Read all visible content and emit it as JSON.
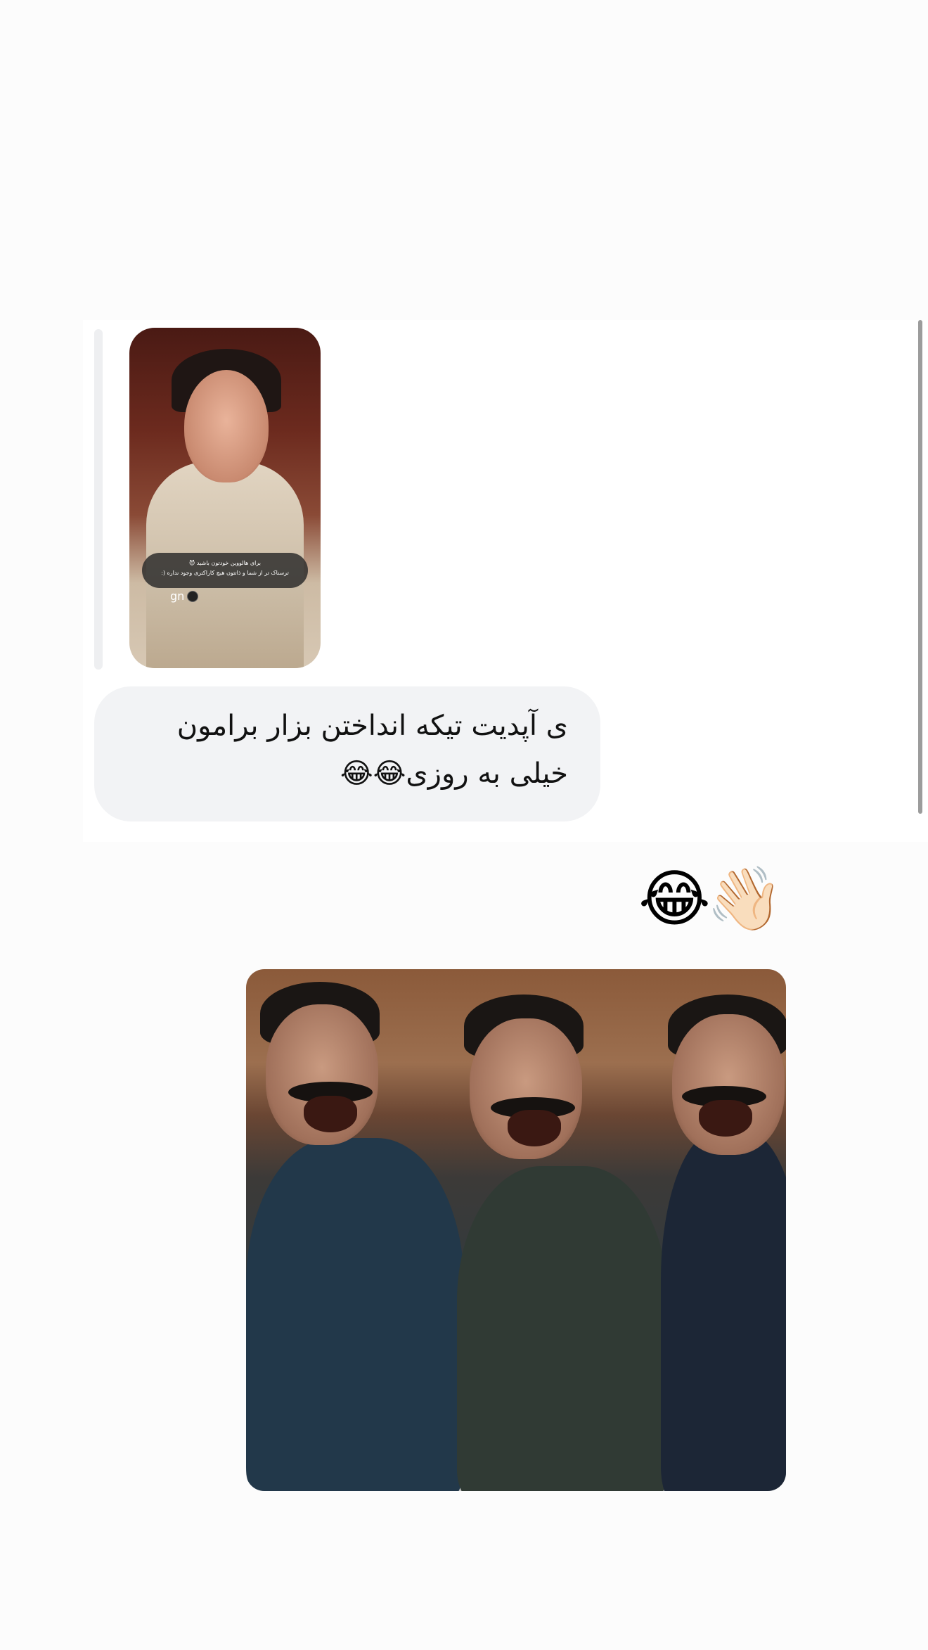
{
  "thread": {
    "story_reply": {
      "caption_line1": "برای هالووین خودتون باشید 😈",
      "caption_line2": "ترسناک تر از شما و ذاتتون هیچ کاراکتری وجود نداره (:",
      "tag": "gn"
    },
    "message": {
      "line1": "ی آپدیت تیکه انداختن بزار برامون",
      "line2": "خیلی به روزی😂😂"
    }
  },
  "reply": {
    "emoji_text": "😂👋🏻"
  },
  "colors": {
    "background": "#fcfcfc",
    "thread_panel": "#ffffff",
    "bubble": "#f2f3f5",
    "reply_bar": "#eeeff1",
    "scrollbar": "#9c9c9c"
  }
}
